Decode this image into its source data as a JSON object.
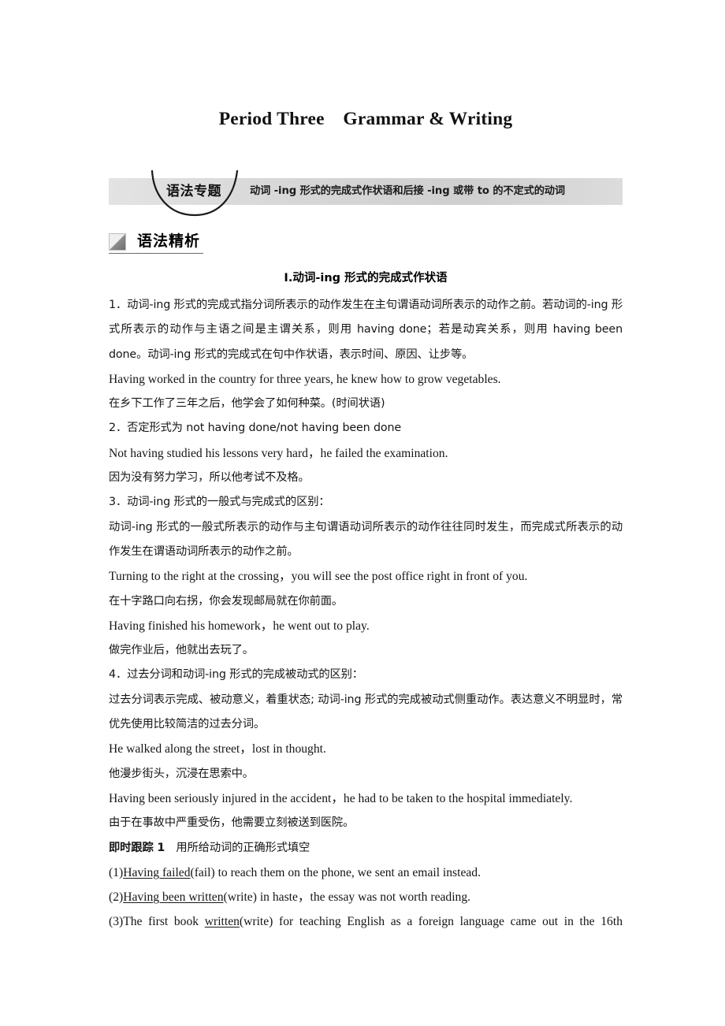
{
  "page": {
    "title": "Period Three Grammar & Writing"
  },
  "banner": {
    "badge_label": "语法专题",
    "topic_text": "动词 -ing 形式的完成式作状语和后接 -ing 或带 to 的不定式的动词",
    "accent_color": "#d7d7d7"
  },
  "section": {
    "header_title": "语法精析",
    "icon_name": "diagonal-square-icon"
  },
  "content": {
    "roman_heading": "Ⅰ.动词-ing 形式的完成式作状语",
    "lines": [
      {
        "id": "p1",
        "kind": "zh-paragraph",
        "text": "1．动词-ing 形式的完成式指分词所表示的动作发生在主句谓语动词所表示的动作之前。若动词的-ing 形式所表示的动作与主语之间是主谓关系，则用 having done；若是动宾关系，则用 having been done。动词-ing 形式的完成式在句中作状语，表示时间、原因、让步等。"
      },
      {
        "id": "p2",
        "kind": "en-example",
        "text": "Having worked in the country for three years, he knew how to grow vegetables."
      },
      {
        "id": "p3",
        "kind": "zh-translation",
        "text": "在乡下工作了三年之后，他学会了如何种菜。(时间状语)"
      },
      {
        "id": "p4",
        "kind": "zh-paragraph",
        "text": "2．否定形式为 not having done/not having been done"
      },
      {
        "id": "p5",
        "kind": "en-example",
        "text": "Not having studied his lessons very hard，he failed the examination."
      },
      {
        "id": "p6",
        "kind": "zh-translation",
        "text": "因为没有努力学习，所以他考试不及格。"
      },
      {
        "id": "p7",
        "kind": "zh-paragraph",
        "text": "3．动词-ing 形式的一般式与完成式的区别："
      },
      {
        "id": "p8",
        "kind": "zh-paragraph",
        "text": "动词-ing 形式的一般式所表示的动作与主句谓语动词所表示的动作往往同时发生，而完成式所表示的动作发生在谓语动词所表示的动作之前。"
      },
      {
        "id": "p9",
        "kind": "en-example",
        "text": "Turning to the right at the crossing，you will see the post office right in front of you."
      },
      {
        "id": "p10",
        "kind": "zh-translation",
        "text": "在十字路口向右拐，你会发现邮局就在你前面。"
      },
      {
        "id": "p11",
        "kind": "en-example",
        "text": "Having finished his homework，he went out to play."
      },
      {
        "id": "p12",
        "kind": "zh-translation",
        "text": "做完作业后，他就出去玩了。"
      },
      {
        "id": "p13",
        "kind": "zh-paragraph",
        "text": "4．过去分词和动词-ing 形式的完成被动式的区别："
      },
      {
        "id": "p14",
        "kind": "zh-paragraph",
        "text": "过去分词表示完成、被动意义，着重状态; 动词-ing 形式的完成被动式侧重动作。表达意义不明显时，常优先使用比较简洁的过去分词。"
      },
      {
        "id": "p15",
        "kind": "en-example",
        "text": "He walked along the street，lost in thought."
      },
      {
        "id": "p16",
        "kind": "zh-translation",
        "text": "他漫步街头，沉浸在思索中。"
      },
      {
        "id": "p17",
        "kind": "en-example",
        "text": "Having been seriously injured in the accident，he had to be taken to the hospital immediately."
      },
      {
        "id": "p18",
        "kind": "zh-translation",
        "text": "由于在事故中严重受伤，他需要立刻被送到医院。"
      }
    ]
  },
  "exercise": {
    "title_bold": "即时跟踪 1",
    "title_rest": "用所给动词的正确形式填空",
    "items": [
      {
        "number": "(1)",
        "answer": "Having failed",
        "cue": "(fail)",
        "rest": " to reach them on the phone, we sent an email instead."
      },
      {
        "number": "(2)",
        "answer": "Having been written",
        "cue": "(write)",
        "rest": " in haste，the essay was not worth reading."
      },
      {
        "number": "(3)",
        "lead": "The first book ",
        "answer": "written",
        "cue": "(write)",
        "rest": " for teaching English as a foreign language came out in the 16th"
      }
    ]
  }
}
